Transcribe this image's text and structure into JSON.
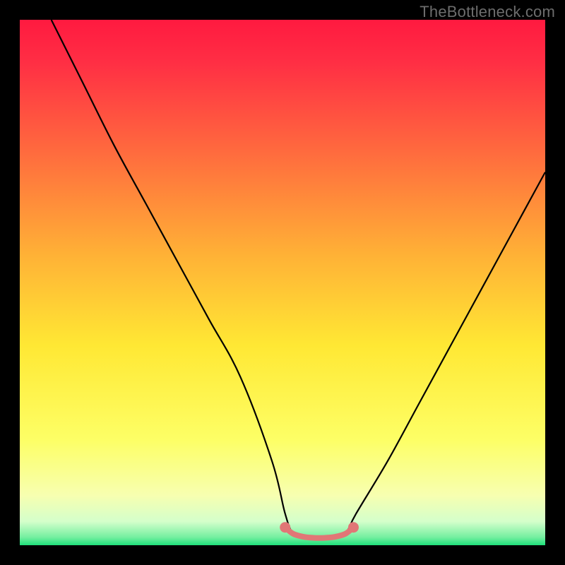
{
  "watermark": "TheBottleneck.com",
  "colors": {
    "gradient_top": "#ff1a40",
    "gradient_mid": "#ffe834",
    "gradient_near_bottom": "#f7ffb0",
    "gradient_bottom": "#1ee07a",
    "curve_line": "#000000",
    "bottom_accent": "#e17676",
    "watermark_color": "#6d6d6d",
    "frame_bg": "#000000"
  },
  "chart_data": {
    "type": "line",
    "title": "",
    "xlabel": "",
    "ylabel": "",
    "xlim": [
      0,
      100
    ],
    "ylim": [
      0,
      100
    ],
    "grid": false,
    "series": [
      {
        "name": "bottleneck-curve",
        "x": [
          6,
          12,
          18,
          24,
          30,
          36,
          42,
          48,
          50.5,
          52,
          54,
          56,
          58,
          60,
          62,
          64,
          70,
          76,
          82,
          88,
          94,
          100
        ],
        "y": [
          100,
          88,
          76,
          65,
          54,
          43,
          32,
          16,
          6,
          2.2,
          1.5,
          1.3,
          1.3,
          1.5,
          2.2,
          6,
          16,
          27,
          38,
          49,
          60,
          71
        ]
      },
      {
        "name": "bottom-flat-accent",
        "x": [
          50.5,
          52,
          54,
          56,
          58,
          60,
          62,
          63.5
        ],
        "y": [
          3.4,
          2.2,
          1.6,
          1.4,
          1.4,
          1.6,
          2.2,
          3.4
        ]
      }
    ],
    "annotations": []
  }
}
